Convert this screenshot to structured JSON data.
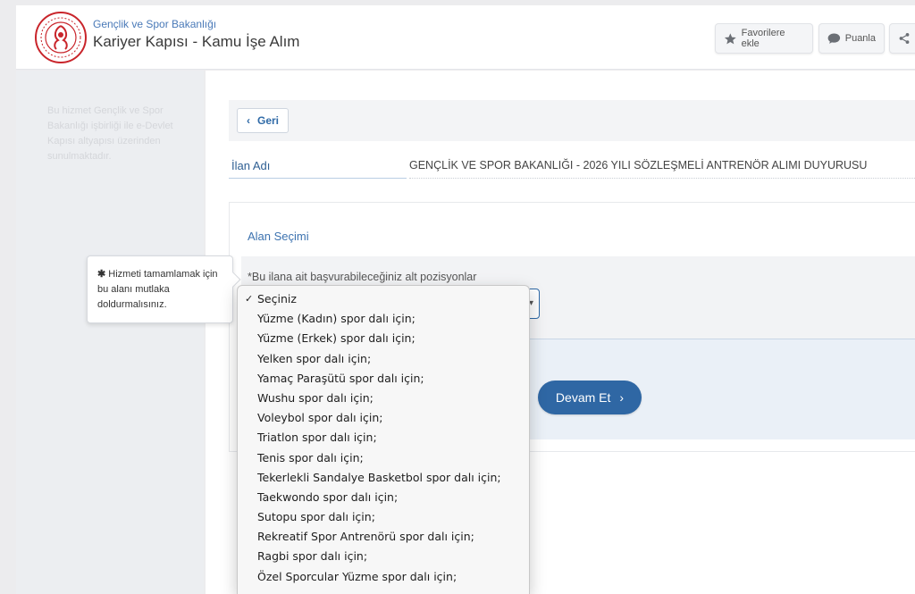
{
  "header": {
    "ministry": "Gençlik ve Spor Bakanlığı",
    "service_title": "Kariyer Kapısı - Kamu İşe Alım",
    "buttons": [
      {
        "label": "Favorilere ekle",
        "icon": "star-icon"
      },
      {
        "label": "Puanla",
        "icon": "speech-bubble-icon"
      },
      {
        "label": "",
        "icon": "share-icon"
      }
    ]
  },
  "sidebar": {
    "note": "Bu hizmet Gençlik ve Spor Bakanlığı işbirliği ile e-Devlet Kapısı altyapısı üzerinden sunulmaktadır."
  },
  "back_button": {
    "label": "Geri"
  },
  "listing": {
    "label": "İlan Adı",
    "value": "GENÇLİK VE SPOR BAKANLIĞI - 2026 YILI SÖZLEŞMELİ ANTRENÖR ALIMI DUYURUSU"
  },
  "form": {
    "section_title": "Alan Seçimi",
    "required_mark": "*",
    "field_label": "Bu ilana ait başvurabileceğiniz alt pozisyonlar",
    "selected_option": "Seçiniz",
    "options": [
      "Seçiniz",
      "Yüzme (Kadın) spor dalı için;",
      "Yüzme (Erkek) spor dalı için;",
      "Yelken spor dalı için;",
      "Yamaç Paraşütü spor dalı için;",
      "Wushu spor dalı için;",
      "Voleybol spor dalı için;",
      "Triatlon spor dalı için;",
      "Tenis spor dalı için;",
      "Tekerlekli Sandalye Basketbol spor dalı için;",
      "Taekwondo spor dalı için;",
      "Sutopu spor dalı için;",
      "Rekreatif Spor Antrenörü spor dalı için;",
      "Ragbi spor dalı için;",
      "Özel Sporcular Yüzme spor dalı için;"
    ],
    "submit_label": "Devam Et"
  },
  "tooltip": {
    "asterisk": "✱",
    "text": "Hizmeti tamamlamak için bu alanı mutlaka doldurmalısınız."
  },
  "colors": {
    "brand_blue": "#2f67a4",
    "ministry_red": "#c9252b"
  }
}
